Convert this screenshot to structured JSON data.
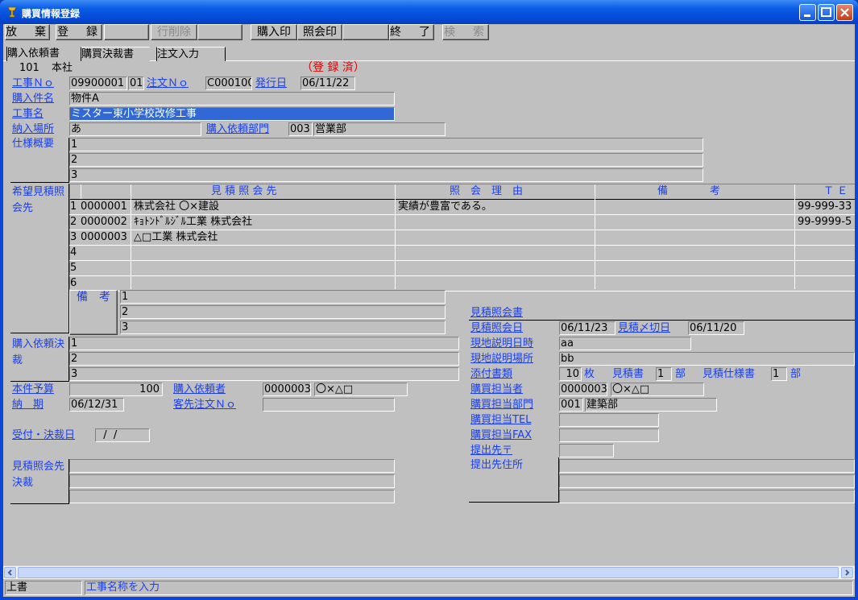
{
  "window": {
    "title": "購買情報登録"
  },
  "toolbar": {
    "discard": "放　棄",
    "register": "登　録",
    "delete_row": "行削除",
    "purchase_print": "購入印",
    "inquiry_print": "照会印",
    "end": "終　了",
    "search": "検　索"
  },
  "tabs": [
    "購入依頼書",
    "購買決裁書",
    "注文入力"
  ],
  "header": {
    "company_code": "101",
    "company_name": "本社",
    "status": "（登 録 済）"
  },
  "labels": {
    "job_no": "工事Ｎｏ",
    "order_no": "注文Ｎｏ",
    "issue_date": "発行日",
    "item_name": "購入件名",
    "job_name": "工事名",
    "delivery": "納入場所",
    "dept": "購入依頼部門",
    "spec": "仕様概要",
    "quote_ref": "希望見積照会先",
    "remark": "備　考",
    "purchase_decision": "購入依頼決裁",
    "budget": "本件予算",
    "requester": "購入依頼者",
    "deadline": "納　期",
    "client_order": "客先注文Ｎｏ",
    "received": "受付・決裁日",
    "quote_decision": "見積照会先決裁",
    "quote_inquiry": "見積照会書",
    "quote_date": "見積照会日",
    "quote_deadline": "見積〆切日",
    "site_explain_date": "現地説明日時",
    "site_explain_place": "現地説明場所",
    "attachments": "添付書類",
    "purchase_staff": "購買担当者",
    "purchase_dept": "購買担当部門",
    "purchase_tel": "購買担当TEL",
    "purchase_fax": "購買担当FAX",
    "submit_zip": "提出先〒",
    "submit_address": "提出先住所"
  },
  "fields": {
    "job_no": "09900001",
    "job_no_sub": "01",
    "order_no": "C000100",
    "issue_date": "06/11/22",
    "item_name": "物件A",
    "job_name": "ミスター東小学校改修工事",
    "delivery": "あ",
    "dept_code": "003",
    "dept_name": "営業部",
    "spec": [
      "1",
      "2",
      "3"
    ],
    "remark": [
      "1",
      "2",
      "3"
    ],
    "decision": [
      "1",
      "2",
      "3"
    ],
    "budget": "100",
    "requester_code": "0000003",
    "requester_name": "〇×△□",
    "deadline": "06/12/31",
    "client_order": "",
    "received": "  /  /",
    "quote_date": "06/11/23",
    "quote_deadline": "06/11/20",
    "site_date": "aa",
    "site_place": "bb",
    "attach_count": "10",
    "attach_unit": "枚",
    "est_label": "見積書",
    "est_count": "1",
    "est_unit": "部",
    "spec_label": "見積仕様書",
    "spec_count": "1",
    "spec_unit": "部",
    "staff_code": "0000003",
    "staff_name": "〇×△□",
    "pdept_code": "001",
    "pdept_name": "建築部"
  },
  "grid": {
    "headers": [
      "見 積 照 会 先",
      "照　会　理　由",
      "備　　　　考",
      "Ｔ Ｅ"
    ],
    "rows": [
      {
        "no": "1",
        "code": "0000001",
        "name": "株式会社 〇×建設",
        "reason": "実績が豊富である。",
        "tel": "99-999-33"
      },
      {
        "no": "2",
        "code": "0000002",
        "name": "ｷｮﾄﾝﾄﾞﾙｼﾞﾙ工業 株式会社",
        "reason": "",
        "tel": "99-9999-5"
      },
      {
        "no": "3",
        "code": "0000003",
        "name": "△□工業 株式会社",
        "reason": "",
        "tel": ""
      },
      {
        "no": "4",
        "code": "",
        "name": "",
        "reason": "",
        "tel": ""
      },
      {
        "no": "5",
        "code": "",
        "name": "",
        "reason": "",
        "tel": ""
      },
      {
        "no": "6",
        "code": "",
        "name": "",
        "reason": "",
        "tel": ""
      }
    ]
  },
  "status": {
    "mode": "上書",
    "hint": "工事名称を入力"
  }
}
